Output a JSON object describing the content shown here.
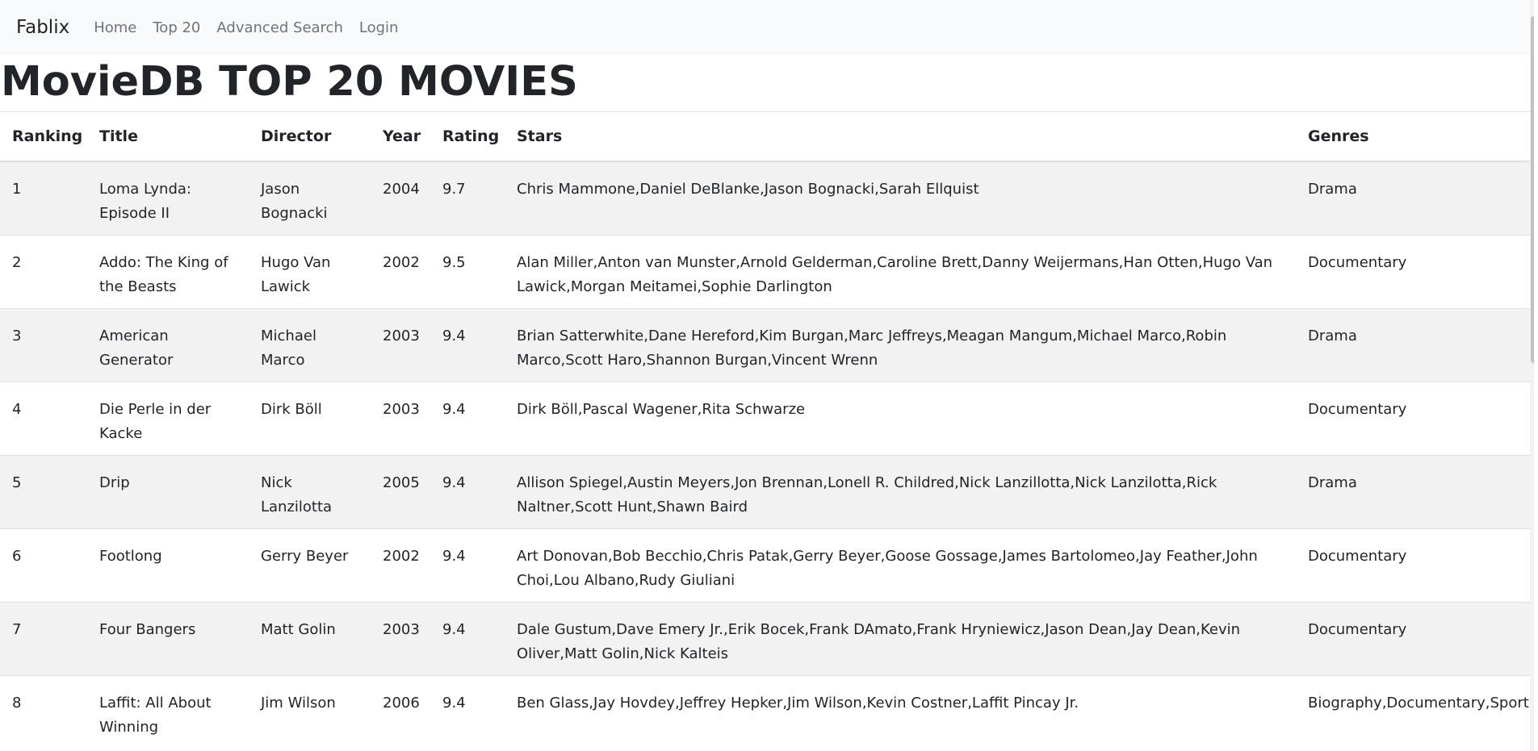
{
  "navbar": {
    "brand": "Fablix",
    "links": [
      "Home",
      "Top 20",
      "Advanced Search",
      "Login"
    ]
  },
  "page_title": "MovieDB TOP 20 MOVIES",
  "table": {
    "headers": [
      "Ranking",
      "Title",
      "Director",
      "Year",
      "Rating",
      "Stars",
      "Genres"
    ],
    "rows": [
      {
        "ranking": "1",
        "title": "Loma Lynda: Episode II",
        "director": "Jason Bognacki",
        "year": "2004",
        "rating": "9.7",
        "stars": "Chris Mammone,Daniel DeBlanke,Jason Bognacki,Sarah Ellquist",
        "genres": "Drama"
      },
      {
        "ranking": "2",
        "title": "Addo: The King of the Beasts",
        "director": "Hugo Van Lawick",
        "year": "2002",
        "rating": "9.5",
        "stars": "Alan Miller,Anton van Munster,Arnold Gelderman,Caroline Brett,Danny Weijermans,Han Otten,Hugo Van Lawick,Morgan Meitamei,Sophie Darlington",
        "genres": "Documentary"
      },
      {
        "ranking": "3",
        "title": "American Generator",
        "director": "Michael Marco",
        "year": "2003",
        "rating": "9.4",
        "stars": "Brian Satterwhite,Dane Hereford,Kim Burgan,Marc Jeffreys,Meagan Mangum,Michael Marco,Robin Marco,Scott Haro,Shannon Burgan,Vincent Wrenn",
        "genres": "Drama"
      },
      {
        "ranking": "4",
        "title": "Die Perle in der Kacke",
        "director": "Dirk Böll",
        "year": "2003",
        "rating": "9.4",
        "stars": "Dirk Böll,Pascal Wagener,Rita Schwarze",
        "genres": "Documentary"
      },
      {
        "ranking": "5",
        "title": "Drip",
        "director": "Nick Lanzilotta",
        "year": "2005",
        "rating": "9.4",
        "stars": "Allison Spiegel,Austin Meyers,Jon Brennan,Lonell R. Childred,Nick Lanzillotta,Nick Lanzilotta,Rick Naltner,Scott Hunt,Shawn Baird",
        "genres": "Drama"
      },
      {
        "ranking": "6",
        "title": "Footlong",
        "director": "Gerry Beyer",
        "year": "2002",
        "rating": "9.4",
        "stars": "Art Donovan,Bob Becchio,Chris Patak,Gerry Beyer,Goose Gossage,James Bartolomeo,Jay Feather,John Choi,Lou Albano,Rudy Giuliani",
        "genres": "Documentary"
      },
      {
        "ranking": "7",
        "title": "Four Bangers",
        "director": "Matt Golin",
        "year": "2003",
        "rating": "9.4",
        "stars": "Dale Gustum,Dave Emery Jr.,Erik Bocek,Frank DAmato,Frank Hryniewicz,Jason Dean,Jay Dean,Kevin Oliver,Matt Golin,Nick Kalteis",
        "genres": "Documentary"
      },
      {
        "ranking": "8",
        "title": "Laffit: All About Winning",
        "director": "Jim Wilson",
        "year": "2006",
        "rating": "9.4",
        "stars": "Ben Glass,Jay Hovdey,Jeffrey Hepker,Jim Wilson,Kevin Costner,Laffit Pincay Jr.",
        "genres": "Biography,Documentary,Sport"
      }
    ]
  }
}
